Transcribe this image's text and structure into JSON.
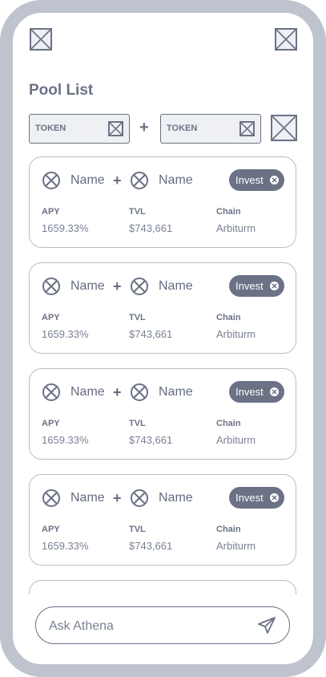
{
  "header": {
    "left_icon": "image-placeholder-icon",
    "right_icon": "image-placeholder-icon"
  },
  "page": {
    "title": "Pool List"
  },
  "filter": {
    "token_a_label": "TOKEN",
    "token_b_label": "TOKEN",
    "plus": "+",
    "token_icon": "image-placeholder-icon",
    "action_icon": "image-placeholder-icon"
  },
  "pools": [
    {
      "token_a": "Name",
      "token_b": "Name",
      "plus": "+",
      "invest_label": "Invest",
      "apy_label": "APY",
      "apy": "1659.33%",
      "tvl_label": "TVL",
      "tvl": "$743,661",
      "chain_label": "Chain",
      "chain": "Arbiturm"
    },
    {
      "token_a": "Name",
      "token_b": "Name",
      "plus": "+",
      "invest_label": "Invest",
      "apy_label": "APY",
      "apy": "1659.33%",
      "tvl_label": "TVL",
      "tvl": "$743,661",
      "chain_label": "Chain",
      "chain": "Arbiturm"
    },
    {
      "token_a": "Name",
      "token_b": "Name",
      "plus": "+",
      "invest_label": "Invest",
      "apy_label": "APY",
      "apy": "1659.33%",
      "tvl_label": "TVL",
      "tvl": "$743,661",
      "chain_label": "Chain",
      "chain": "Arbiturm"
    },
    {
      "token_a": "Name",
      "token_b": "Name",
      "plus": "+",
      "invest_label": "Invest",
      "apy_label": "APY",
      "apy": "1659.33%",
      "tvl_label": "TVL",
      "tvl": "$743,661",
      "chain_label": "Chain",
      "chain": "Arbiturm"
    }
  ],
  "chat": {
    "placeholder": "Ask Athena",
    "send_icon": "send-icon"
  },
  "colors": {
    "frame": "#bec3cd",
    "primary": "#6b7285",
    "text": "#636b7e",
    "placeholder_fill": "#eef0f4",
    "card_border": "#b9bec9"
  }
}
